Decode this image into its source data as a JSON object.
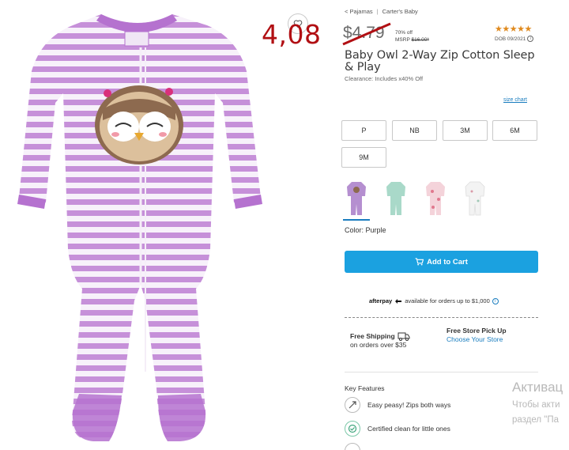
{
  "overlay": {
    "handwritten_price": "4,08"
  },
  "breadcrumb": {
    "back": "< Pajamas",
    "current": "Carter's  Baby"
  },
  "price": {
    "sale": "$4.79",
    "discount": "70% off",
    "msrp_label": "MSRP",
    "msrp_value": "$16.00*"
  },
  "rating": {
    "stars": "★★★★★",
    "dob": "DOB 09/2021"
  },
  "product": {
    "title": "Baby Owl 2-Way Zip Cotton Sleep & Play",
    "clearance": "Clearance: Includes x40% Off"
  },
  "size_chart_label": "size chart",
  "sizes": [
    "P",
    "NB",
    "3M",
    "6M",
    "9M"
  ],
  "swatches": [
    {
      "name": "Purple",
      "color": "#b58fd0"
    },
    {
      "name": "Mint",
      "color": "#a9d9c9"
    },
    {
      "name": "Pink floral",
      "color": "#efb7c2"
    },
    {
      "name": "White floral",
      "color": "#e8e8e8"
    }
  ],
  "color_label": "Color: Purple",
  "add_to_cart": "Add to Cart",
  "afterpay": {
    "brand": "afterpay",
    "text": "available for orders up to $1,000"
  },
  "shipping": {
    "free_shipping": "Free Shipping",
    "free_shipping_sub": "on orders over $35",
    "pickup": "Free Store Pick Up",
    "choose_store": "Choose Your Store"
  },
  "features": {
    "title": "Key Features",
    "items": [
      "Easy peasy! Zips both ways",
      "Certified clean for little ones"
    ]
  },
  "watermark": {
    "title": "Активац",
    "line1": "Чтобы акти",
    "line2": "раздел \"Па"
  },
  "colors": {
    "accent": "#1ba1e0",
    "link": "#1a7dbf",
    "price_red": "#b10f13",
    "stripe": "#c78cd6"
  }
}
